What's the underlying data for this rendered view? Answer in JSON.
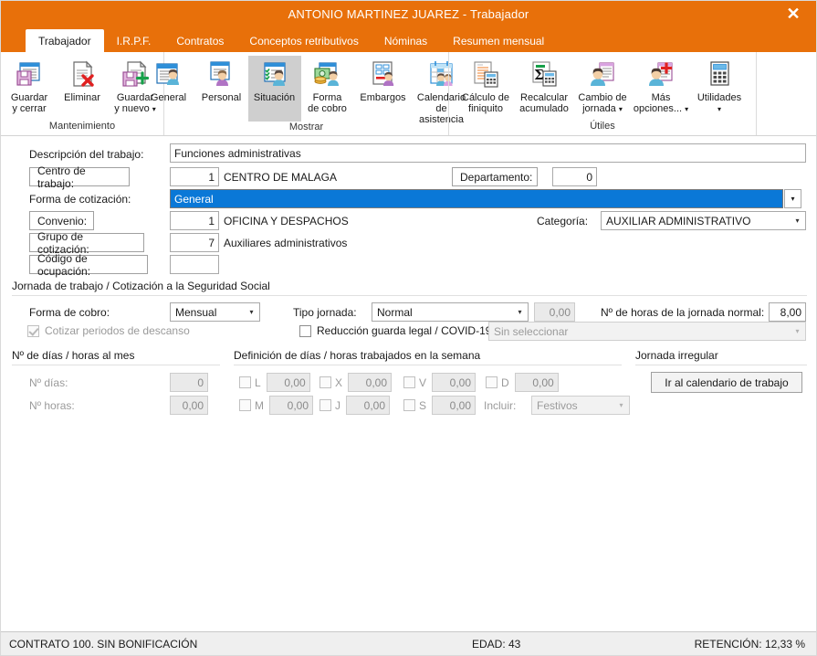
{
  "window": {
    "title": "ANTONIO MARTINEZ JUAREZ - Trabajador",
    "close_label": "✕",
    "accent_color": "#e8700a",
    "selection_color": "#0a78d7"
  },
  "tabs": [
    {
      "label": "Trabajador",
      "active": true
    },
    {
      "label": "I.R.P.F.",
      "active": false
    },
    {
      "label": "Contratos",
      "active": false
    },
    {
      "label": "Conceptos retributivos",
      "active": false
    },
    {
      "label": "Nóminas",
      "active": false
    },
    {
      "label": "Resumen mensual",
      "active": false
    }
  ],
  "ribbon": {
    "groups": [
      {
        "label": "Mantenimiento",
        "buttons": [
          {
            "icon": "save-close-icon",
            "line1": "Guardar",
            "line2": "y cerrar",
            "caret": false,
            "selected": false
          },
          {
            "icon": "delete-icon",
            "line1": "Eliminar",
            "line2": "",
            "caret": false,
            "selected": false
          },
          {
            "icon": "save-new-icon",
            "line1": "Guardar",
            "line2": "y nuevo",
            "caret": true,
            "selected": false
          }
        ]
      },
      {
        "label": "Mostrar",
        "buttons": [
          {
            "icon": "general-icon",
            "line1": "General",
            "line2": "",
            "caret": false,
            "selected": false
          },
          {
            "icon": "personal-icon",
            "line1": "Personal",
            "line2": "",
            "caret": false,
            "selected": false
          },
          {
            "icon": "situacion-icon",
            "line1": "Situación",
            "line2": "",
            "caret": false,
            "selected": true
          },
          {
            "icon": "forma-cobro-icon",
            "line1": "Forma",
            "line2": "de cobro",
            "caret": false,
            "selected": false
          },
          {
            "icon": "embargos-icon",
            "line1": "Embargos",
            "line2": "",
            "caret": false,
            "selected": false
          },
          {
            "icon": "calendario-asistencia-icon",
            "line1": "Calendario",
            "line2": "de asistencia",
            "caret": false,
            "selected": false
          }
        ]
      },
      {
        "label": "Útiles",
        "buttons": [
          {
            "icon": "calculo-finiquito-icon",
            "line1": "Cálculo de",
            "line2": "finiquito",
            "caret": false,
            "selected": false
          },
          {
            "icon": "recalcular-icon",
            "line1": "Recalcular",
            "line2": "acumulado",
            "caret": false,
            "selected": false
          },
          {
            "icon": "cambio-jornada-icon",
            "line1": "Cambio de",
            "line2": "jornada",
            "caret": true,
            "selected": false
          },
          {
            "icon": "mas-opciones-icon",
            "line1": "Más",
            "line2": "opciones...",
            "caret": true,
            "selected": false
          },
          {
            "icon": "utilidades-icon",
            "line1": "Utilidades",
            "line2": "",
            "caret": true,
            "selected": false
          }
        ]
      }
    ]
  },
  "form": {
    "descripcion_label": "Descripción del trabajo:",
    "descripcion_value": "Funciones administrativas",
    "centro_trabajo_label": "Centro de trabajo:",
    "centro_trabajo_code": "1",
    "centro_trabajo_name": "CENTRO DE MALAGA",
    "departamento_label": "Departamento:",
    "departamento_value": "0",
    "forma_cotizacion_label": "Forma de cotización:",
    "forma_cotizacion_value": "General",
    "convenio_label": "Convenio:",
    "convenio_code": "1",
    "convenio_name": "OFICINA Y DESPACHOS",
    "categoria_label": "Categoría:",
    "categoria_value": "AUXILIAR ADMINISTRATIVO",
    "grupo_cotizacion_label": "Grupo de cotización:",
    "grupo_cotizacion_code": "7",
    "grupo_cotizacion_name": "Auxiliares administrativos",
    "codigo_ocupacion_label": "Código de ocupación:",
    "codigo_ocupacion_value": ""
  },
  "jornada": {
    "section_title": "Jornada de trabajo / Cotización a la Seguridad Social",
    "forma_cobro_label": "Forma de cobro:",
    "forma_cobro_value": "Mensual",
    "cotizar_descanso_label": "Cotizar periodos de descanso",
    "cotizar_descanso_checked": true,
    "tipo_jornada_label": "Tipo jornada:",
    "tipo_jornada_value": "Normal",
    "tipo_jornada_extra_value": "0,00",
    "reduccion_label": "Reducción guarda legal / COVID-19",
    "reduccion_checked": false,
    "reduccion_select_value": "Sin seleccionar",
    "horas_jornada_label": "Nº de horas de la jornada normal:",
    "horas_jornada_value": "8,00"
  },
  "dias_mes": {
    "section_title": "Nº de días / horas al mes",
    "dias_label": "Nº días:",
    "dias_value": "0",
    "horas_label": "Nº horas:",
    "horas_value": "0,00"
  },
  "semana": {
    "section_title": "Definición de días / horas trabajados en la semana",
    "days": [
      {
        "code": "L",
        "value": "0,00",
        "checked": false
      },
      {
        "code": "M",
        "value": "0,00",
        "checked": false
      },
      {
        "code": "X",
        "value": "0,00",
        "checked": false
      },
      {
        "code": "J",
        "value": "0,00",
        "checked": false
      },
      {
        "code": "V",
        "value": "0,00",
        "checked": false
      },
      {
        "code": "S",
        "value": "0,00",
        "checked": false
      },
      {
        "code": "D",
        "value": "0,00",
        "checked": false
      }
    ],
    "incluir_label": "Incluir:",
    "incluir_value": "Festivos"
  },
  "irregular": {
    "section_title": "Jornada irregular",
    "button_label": "Ir al calendario de trabajo"
  },
  "statusbar": {
    "contract": "CONTRATO 100.  SIN BONIFICACIÓN",
    "age": "EDAD: 43",
    "retention": "RETENCIÓN: 12,33 %"
  }
}
